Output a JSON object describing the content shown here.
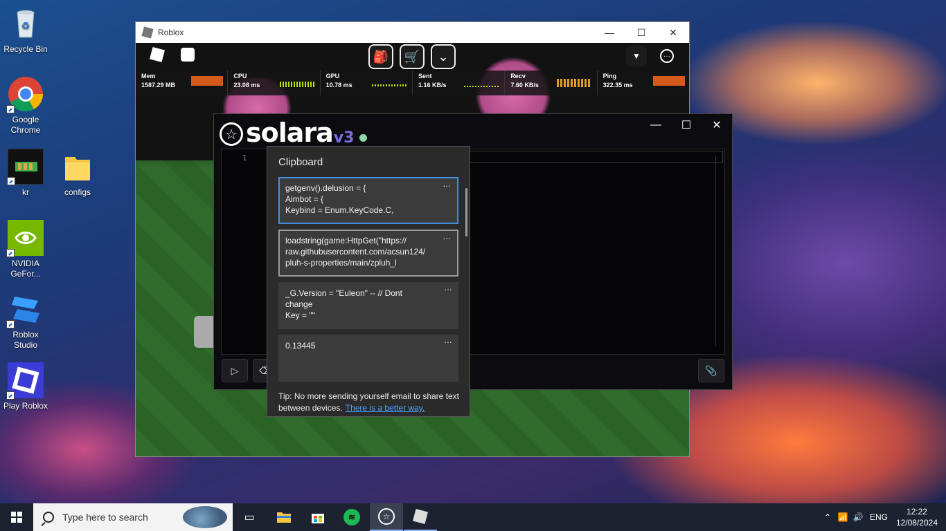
{
  "desktop": {
    "icons": [
      {
        "label": "Recycle Bin"
      },
      {
        "label": "Google Chrome"
      },
      {
        "label": "kr"
      },
      {
        "label": "configs"
      },
      {
        "label": "NVIDIA GeFor..."
      },
      {
        "label": "Roblox Studio"
      },
      {
        "label": "Play Roblox"
      }
    ]
  },
  "roblox": {
    "title": "Roblox",
    "controls": {
      "minimize": "—",
      "maximize": "☐",
      "close": "✕"
    },
    "stats": [
      {
        "label": "Mem",
        "value": "1587.29 MB"
      },
      {
        "label": "CPU",
        "value": "23.08 ms"
      },
      {
        "label": "GPU",
        "value": "10.78 ms"
      },
      {
        "label": "Sent",
        "value": "1.16 KB/s"
      },
      {
        "label": "Recv",
        "value": "7.60 KB/s"
      },
      {
        "label": "Ping",
        "value": "322.35 ms"
      }
    ]
  },
  "solara": {
    "name": "solara",
    "version": "v3",
    "status_color": "#8fd8a8",
    "controls": {
      "minimize": "—",
      "maximize": "☐",
      "close": "✕"
    },
    "editor": {
      "line_number": "1"
    }
  },
  "clipboard": {
    "title": "Clipboard",
    "items": [
      {
        "line1": "getgenv().delusion = {",
        "line2": "Aimbot = {",
        "line3": "Keybind = Enum.KeyCode.C,",
        "more": "···"
      },
      {
        "line1": "loadstring(game:HttpGet(\"https://",
        "line2": "raw.githubusercontent.com/acsun124/",
        "line3": "pluh-s-properties/main/zpluh_l",
        "more": "···"
      },
      {
        "line1": "_G.Version = \"Euleon\" -- // Dont",
        "line2": "change",
        "line3": "Key = \"\"",
        "more": "···"
      },
      {
        "line1": "0.13445",
        "line2": "",
        "line3": "",
        "more": "···"
      }
    ],
    "tip_text": "Tip: No more sending yourself email to share text between devices.",
    "tip_link": "There is a better way."
  },
  "taskbar": {
    "search_placeholder": "Type here to search",
    "language": "ENG",
    "time": "12:22",
    "date": "12/08/2024"
  },
  "colors": {
    "accent": "#3d8fe6",
    "solara_purple": "#7a6de0",
    "taskbar_bg": "#1c2230"
  }
}
